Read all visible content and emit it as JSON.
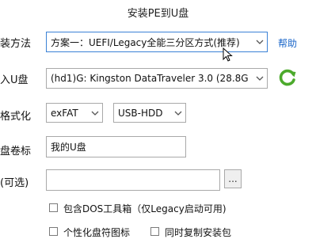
{
  "window": {
    "title": "安装PE到U盘"
  },
  "form": {
    "method": {
      "label": "装方法",
      "value": "方案一：UEFI/Legacy全能三分区方式(推荐)",
      "help": "帮助"
    },
    "drive": {
      "label": "入U盘",
      "value": "(hd1)G: Kingston DataTraveler 3.0 (28.8G"
    },
    "format": {
      "label": "格式化",
      "fs": "exFAT",
      "mode": "USB-HDD"
    },
    "volume": {
      "label": "盘卷标",
      "value": "我的U盘"
    },
    "optional": {
      "label": "(可选)",
      "value": "",
      "browse": "..."
    }
  },
  "options": {
    "dos_tools": "包含DOS工具箱（仅Legacy启动可用)",
    "custom_icon": "个性化盘符图标",
    "copy_installer": "同时复制安装包"
  },
  "colors": {
    "accent_green": "#4caa2c",
    "link_blue": "#1a66c9",
    "focus_border": "#3b82d6"
  }
}
